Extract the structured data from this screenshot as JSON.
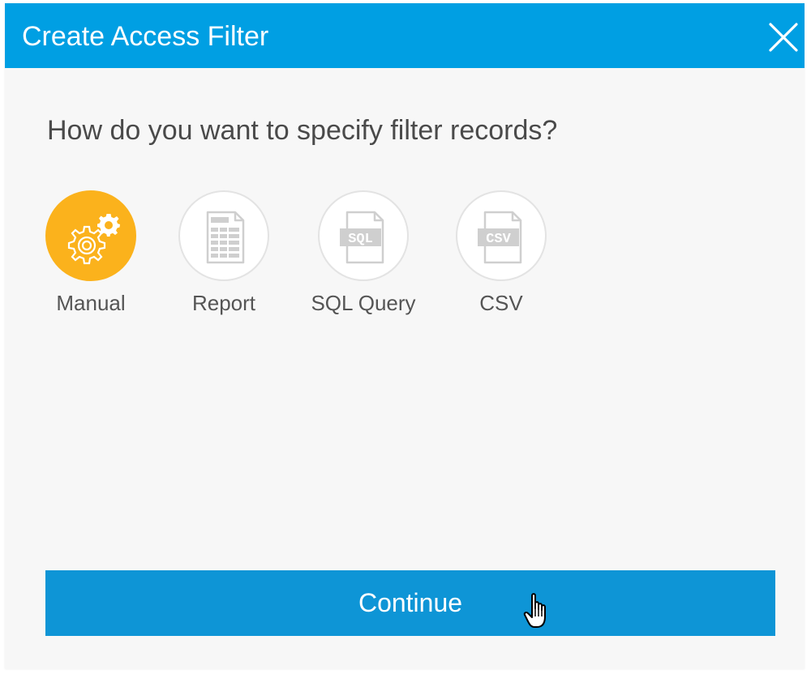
{
  "dialog": {
    "title": "Create Access Filter",
    "close_icon": "close-icon",
    "question": "How do you want to specify filter records?",
    "options": [
      {
        "label": "Manual",
        "icon": "gears-icon",
        "selected": true
      },
      {
        "label": "Report",
        "icon": "report-document-icon",
        "selected": false
      },
      {
        "label": "SQL Query",
        "icon": "sql-document-icon",
        "icon_text": "SQL",
        "selected": false
      },
      {
        "label": "CSV",
        "icon": "csv-document-icon",
        "icon_text": "CSV",
        "selected": false
      }
    ],
    "continue_label": "Continue"
  },
  "colors": {
    "header": "#009fe3",
    "selected_option": "#fbb21c",
    "continue_button": "#0e95d6",
    "background": "#f7f7f7"
  },
  "cursor": "hand-pointer-icon"
}
